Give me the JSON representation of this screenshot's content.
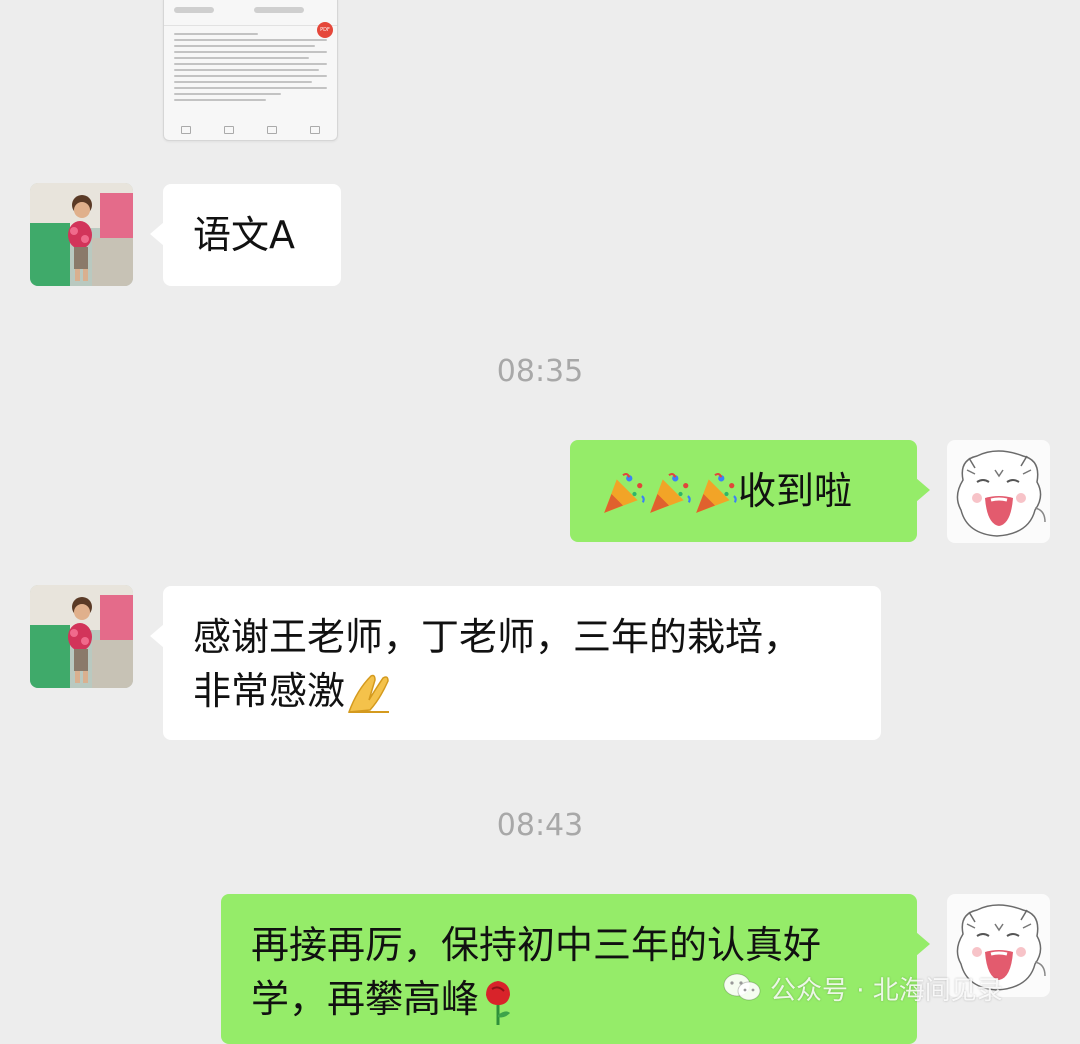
{
  "chat": {
    "messages": [
      {
        "kind": "file-preview",
        "side": "left"
      },
      {
        "kind": "text",
        "side": "left",
        "text": "语文A"
      },
      {
        "kind": "time",
        "text": "08:35"
      },
      {
        "kind": "text",
        "side": "right",
        "text": "收到啦",
        "emoji_prefix": [
          "party-popper",
          "party-popper",
          "party-popper"
        ]
      },
      {
        "kind": "text",
        "side": "left",
        "line1": "感谢王老师，丁老师，三年的栽培，",
        "line2": "非常感激",
        "emoji_suffix": "folded-hands"
      },
      {
        "kind": "time",
        "text": "08:43"
      },
      {
        "kind": "text",
        "side": "right",
        "line1": "再接再厉，保持初中三年的认真好",
        "line2": "学，再攀高峰",
        "emoji_suffix": "rose"
      }
    ]
  },
  "watermark": {
    "text": "公众号 · 北海间见录",
    "icon": "wechat-icon"
  },
  "colors": {
    "background": "#ededed",
    "incoming_bubble": "#ffffff",
    "outgoing_bubble": "#95ec69",
    "timestamp": "#a8a8a8"
  }
}
